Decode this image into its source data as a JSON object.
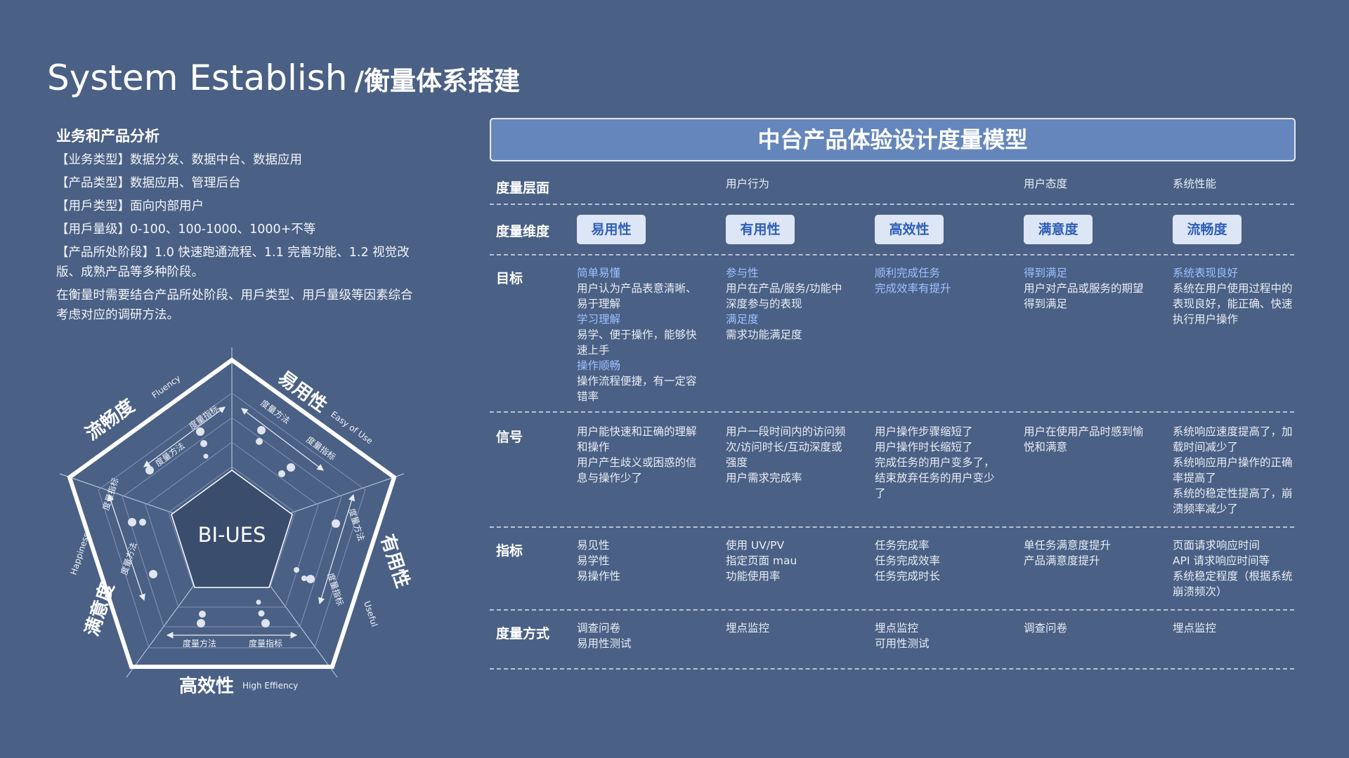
{
  "title": {
    "main": "System Establish",
    "sub": "/衡量体系搭建"
  },
  "analysis": {
    "heading": "业务和产品分析",
    "lines": [
      "【业务类型】数据分发、数据中台、数据应用",
      "【产品类型】数据应用、管理后台",
      "【用戶类型】面向内部用户",
      "【用戶量级】0-100、100-1000、1000+不等",
      "【产品所处阶段】1.0 快速跑通流程、1.1 完善功能、1.2 视觉改版、成熟产品等多种阶段。",
      "在衡量时需要结合产品所处阶段、用戶类型、用戶量级等因素综合考虑对应的调研方法。"
    ]
  },
  "radar": {
    "center": "BI-UES",
    "dims": [
      {
        "cn": "易用性",
        "en": "Easy of Use"
      },
      {
        "cn": "有用性",
        "en": "Useful"
      },
      {
        "cn": "高效性",
        "en": "High Effiency"
      },
      {
        "cn": "满意度",
        "en": "Happiness"
      },
      {
        "cn": "流畅度",
        "en": "Fluency"
      }
    ],
    "method": "度量方法",
    "metric": "度量指标"
  },
  "model": {
    "title": "中台产品体验设计度量模型",
    "levels": {
      "label": "度量层面",
      "behavior": "用户行为",
      "attitude": "用户态度",
      "performance": "系统性能"
    },
    "dims": {
      "label": "度量维度",
      "items": [
        "易用性",
        "有用性",
        "高效性",
        "满意度",
        "流畅度"
      ]
    },
    "goals": {
      "label": "目标",
      "cols": [
        [
          "简单易懂",
          "用户认为产品表意清晰、易于理解",
          "学习理解",
          "易学、便于操作，能够快速上手",
          "操作顺畅",
          "操作流程便捷，有一定容错率"
        ],
        [
          "参与性",
          "用户在产品/服务/功能中深度参与的表现",
          "满足度",
          "需求功能满足度"
        ],
        [
          "顺利完成任务",
          "完成效率有提升"
        ],
        [
          "得到满足",
          "用户对产品或服务的期望得到满足"
        ],
        [
          "系统表现良好",
          "系统在用户使用过程中的表现良好，能正确、快速执行用户操作"
        ]
      ]
    },
    "signals": {
      "label": "信号",
      "cols": [
        "用户能快速和正确的理解和操作\n用户产生歧义或困惑的信息与操作少了",
        "用户一段时间内的访问频次/访问时长/互动深度或强度\n用户需求完成率",
        "用户操作步骤缩短了\n用户操作时长缩短了\n完成任务的用户变多了，结束放弃任务的用户变少了",
        "用户在使用产品时感到愉悦和满意",
        "系统响应速度提高了，加载时间减少了\n系统响应用户操作的正确率提高了\n系统的稳定性提高了，崩溃频率减少了"
      ]
    },
    "metrics": {
      "label": "指标",
      "cols": [
        "易见性\n易学性\n易操作性",
        "使用 UV/PV\n指定页面 mau\n功能使用率",
        "任务完成率\n任务完成效率\n任务完成时长",
        "单任务满意度提升\n产品满意度提升",
        "页面请求响应时间\nAPI 请求响应时间等\n系统稳定程度（根据系统崩溃频次）"
      ]
    },
    "methods": {
      "label": "度量方式",
      "cols": [
        "调查问卷\n易用性测试",
        "埋点监控",
        "埋点监控\n可用性测试",
        "调查问卷",
        "埋点监控"
      ]
    }
  },
  "colors": {
    "bg": "#4a6085",
    "header": "#6486bb",
    "pill_bg": "#dde6f6",
    "pill_text": "#2f5fb5",
    "highlight": "#9ec1ff"
  }
}
